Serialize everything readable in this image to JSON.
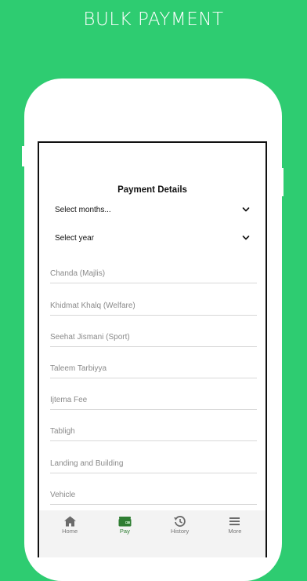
{
  "banner": {
    "title": "BULK PAYMENT"
  },
  "screen": {
    "title": "Payment Details",
    "month_select": {
      "value": "Select months...",
      "icon": "chevron-down-icon"
    },
    "year_select": {
      "value": "Select year",
      "icon": "chevron-down-icon"
    },
    "fields": [
      {
        "placeholder": "Chanda (Majlis)"
      },
      {
        "placeholder": "Khidmat Khalq (Welfare)"
      },
      {
        "placeholder": "Seehat Jismani (Sport)"
      },
      {
        "placeholder": "Taleem Tarbiyya"
      },
      {
        "placeholder": "Ijtema Fee"
      },
      {
        "placeholder": "Tabligh"
      },
      {
        "placeholder": "Landing and Building"
      },
      {
        "placeholder": "Vehicle"
      }
    ]
  },
  "tabbar": {
    "items": [
      {
        "label": "Home",
        "icon": "home-icon",
        "active": false
      },
      {
        "label": "Pay",
        "icon": "wallet-icon",
        "active": true
      },
      {
        "label": "History",
        "icon": "history-icon",
        "active": false
      },
      {
        "label": "More",
        "icon": "menu-icon",
        "active": false
      }
    ]
  },
  "colors": {
    "background": "#2ecc71",
    "active_tab": "#2e7d32",
    "inactive_tab": "#777777"
  }
}
